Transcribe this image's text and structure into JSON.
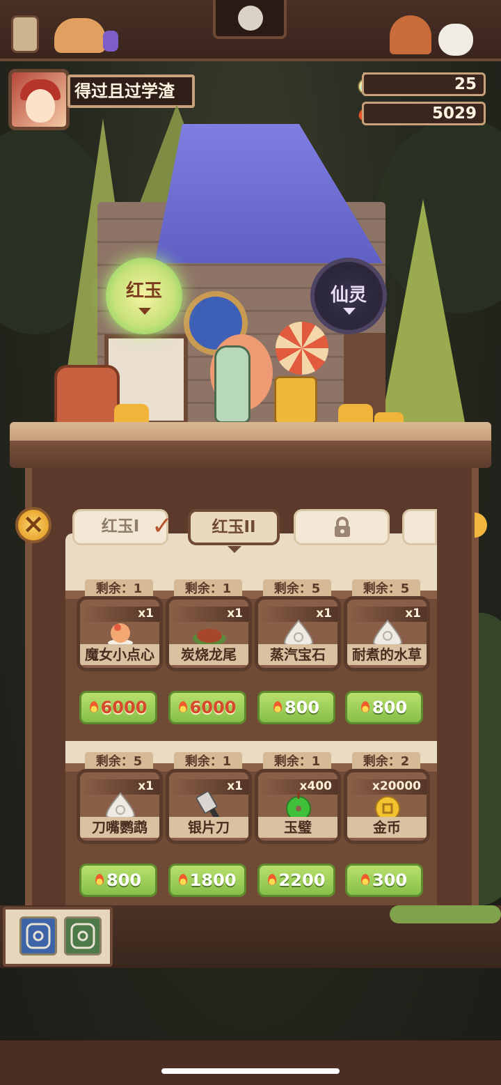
{
  "player": {
    "name": "得过且过学渣"
  },
  "resources": {
    "potion": {
      "value": "25",
      "icon": "potion-icon"
    },
    "fire": {
      "value": "5029",
      "icon": "fire-icon"
    }
  },
  "orbs": {
    "red_jade": "红玉",
    "spirit": "仙灵"
  },
  "tabs": [
    {
      "label": "红玉I"
    },
    {
      "label": "红玉II"
    },
    {
      "label": "",
      "icon": "lock-icon"
    },
    {
      "label": ""
    }
  ],
  "items": [
    {
      "remain": "剩余：1",
      "qty": "x1",
      "name": "魔女小点心",
      "price": "6000",
      "icon": "dessert-icon"
    },
    {
      "remain": "剩余：1",
      "qty": "x1",
      "name": "炭烧龙尾",
      "price": "6000",
      "icon": "roast-icon"
    },
    {
      "remain": "剩余：5",
      "qty": "x1",
      "name": "蒸汽宝石",
      "price": "800",
      "icon": "gem-icon"
    },
    {
      "remain": "剩余：5",
      "qty": "x1",
      "name": "耐煮的水草",
      "price": "800",
      "icon": "gem-icon"
    },
    {
      "remain": "剩余：5",
      "qty": "x1",
      "name": "刀嘴鹦鹉",
      "price": "800",
      "icon": "gem-icon"
    },
    {
      "remain": "剩余：1",
      "qty": "x1",
      "name": "银片刀",
      "price": "1800",
      "icon": "knife-icon"
    },
    {
      "remain": "剩余：1",
      "qty": "x400",
      "name": "玉璧",
      "price": "2200",
      "icon": "jade-icon"
    },
    {
      "remain": "剩余：2",
      "qty": "x20000",
      "name": "金币",
      "price": "300",
      "icon": "coin-icon"
    }
  ],
  "colors": {
    "price_green": "#86bf49",
    "price_red_text": "#d6492c",
    "wood": "#6e4a36"
  }
}
